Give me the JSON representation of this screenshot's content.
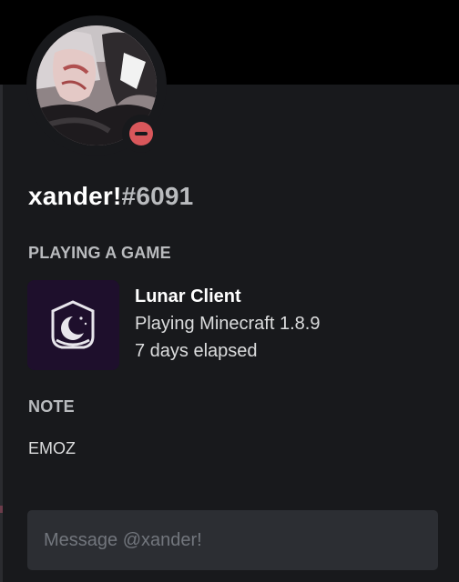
{
  "profile": {
    "username": "xander!",
    "discriminator": "#6091",
    "status": "do-not-disturb",
    "status_color": "#d9575b",
    "avatar_icon": "user-avatar-photo"
  },
  "activity": {
    "section_label": "PLAYING A GAME",
    "game_name": "Lunar Client",
    "details": "Playing Minecraft 1.8.9",
    "elapsed": "7 days elapsed",
    "icon": "lunar-client-icon",
    "icon_bg": "#1e0f2c"
  },
  "note": {
    "section_label": "NOTE",
    "text": "EMOZ"
  },
  "message": {
    "placeholder": "Message @xander!"
  },
  "colors": {
    "background": "#18191c",
    "banner": "#000000",
    "input_bg": "#2c2e33",
    "muted_text": "#b9bbbe"
  }
}
